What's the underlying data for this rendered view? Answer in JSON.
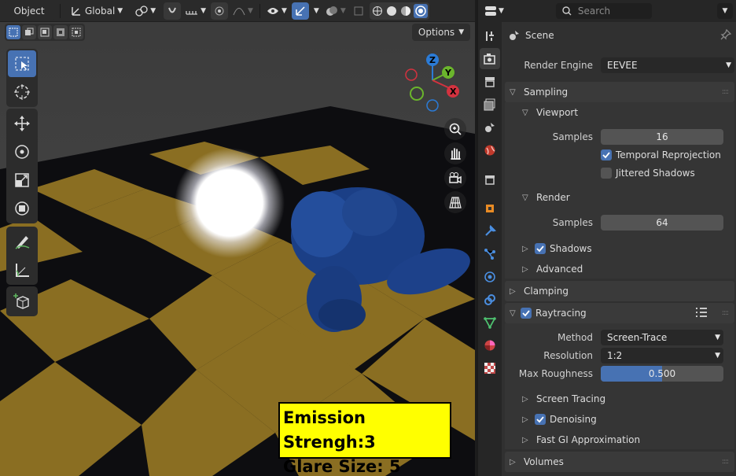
{
  "viewport": {
    "mode_label": "Object",
    "orientation_label": "Global",
    "options_label": "Options",
    "gizmo": {
      "z": "Z",
      "y": "Y",
      "x": "X"
    },
    "overlay_text": {
      "line1": "Emission Strengh:3",
      "line2": "Glare Size: 5"
    }
  },
  "tools": {
    "group1": [
      "select-box-icon",
      "cursor-icon"
    ],
    "group2": [
      "move-icon",
      "rotate-icon",
      "scale-icon",
      "transform-icon"
    ],
    "group3": [
      "annotate-icon",
      "measure-icon"
    ],
    "group4": [
      "add-cube-icon"
    ]
  },
  "properties": {
    "search_placeholder": "Search",
    "context_label": "Scene",
    "render_engine_label": "Render Engine",
    "render_engine_value": "EEVEE",
    "sampling": {
      "title": "Sampling",
      "viewport": {
        "title": "Viewport",
        "samples_label": "Samples",
        "samples_value": "16",
        "temporal_reprojection": {
          "label": "Temporal Reprojection",
          "checked": true
        },
        "jittered_shadows": {
          "label": "Jittered Shadows",
          "checked": false
        }
      },
      "render": {
        "title": "Render",
        "samples_label": "Samples",
        "samples_value": "64"
      },
      "shadows": {
        "label": "Shadows",
        "checked": true
      },
      "advanced": "Advanced"
    },
    "clamping": "Clamping",
    "raytracing": {
      "title": "Raytracing",
      "checked": true,
      "method_label": "Method",
      "method_value": "Screen-Trace",
      "resolution_label": "Resolution",
      "resolution_value": "1:2",
      "max_roughness_label": "Max Roughness",
      "max_roughness_value": "0.500",
      "max_roughness_fraction": 0.5,
      "screen_tracing": "Screen Tracing",
      "denoising": {
        "label": "Denoising",
        "checked": true
      },
      "fast_gi": "Fast GI Approximation"
    },
    "volumes": "Volumes"
  },
  "colors": {
    "accent": "#4772b3",
    "panel": "#303030",
    "header": "#3a3a3a"
  }
}
